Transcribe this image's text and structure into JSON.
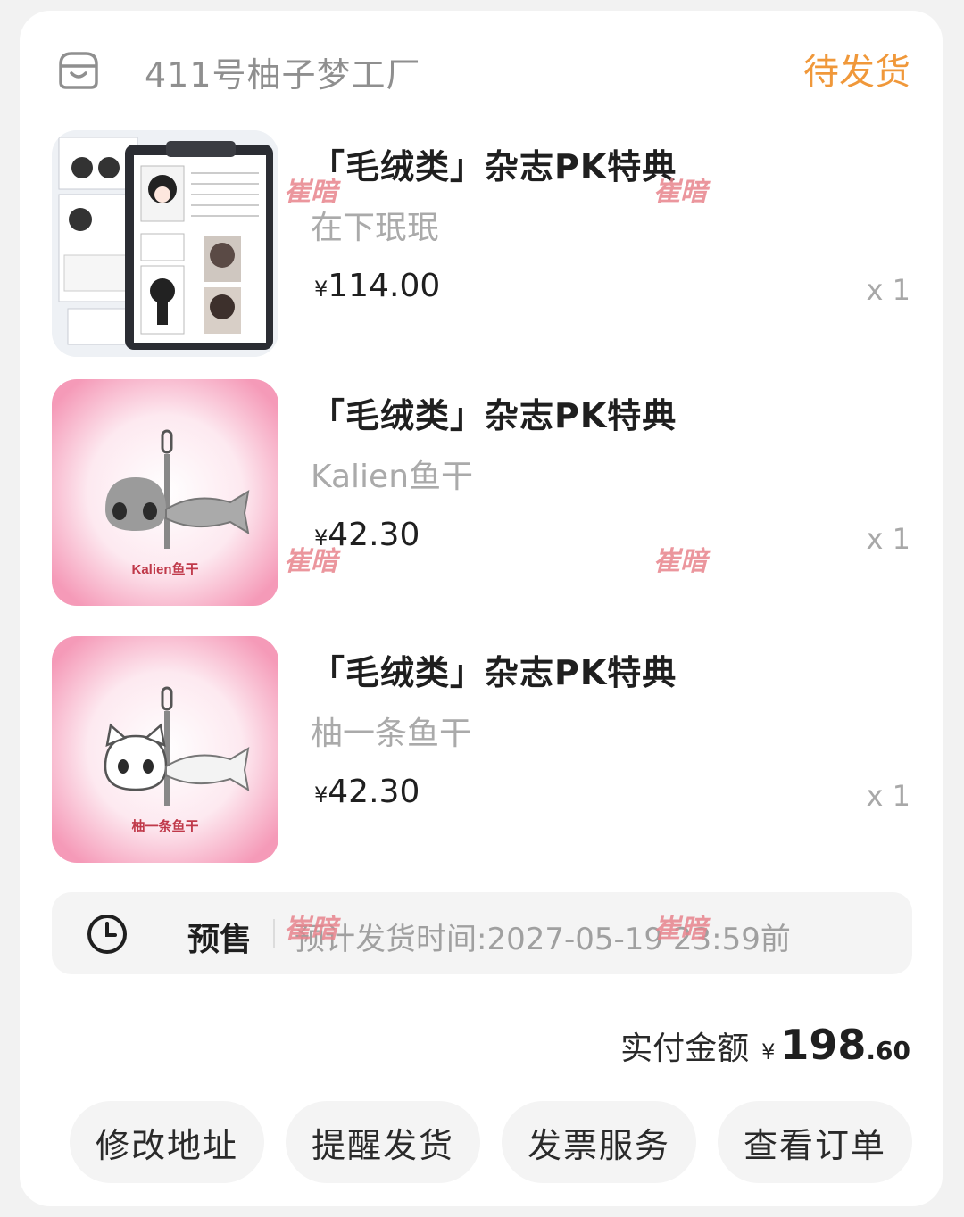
{
  "shop": {
    "name": "411号柚子梦工厂",
    "icon": "shop-icon",
    "status": "待发货"
  },
  "items": [
    {
      "title": "「毛绒类」杂志PK特典",
      "variant": "在下珉珉",
      "price_symbol": "¥",
      "price": "114.00",
      "qty": "x 1"
    },
    {
      "title": "「毛绒类」杂志PK特典",
      "variant": "Kalien鱼干",
      "price_symbol": "¥",
      "price": "42.30",
      "qty": "x 1",
      "image_label": "Kalien鱼干"
    },
    {
      "title": "「毛绒类」杂志PK特典",
      "variant": "柚一条鱼干",
      "price_symbol": "¥",
      "price": "42.30",
      "qty": "x 1",
      "image_label": "柚一条鱼干"
    }
  ],
  "presale": {
    "icon": "clock-icon",
    "label": "预售",
    "text": "预计发货时间:2027-05-19 23:59前"
  },
  "total": {
    "label": "实付金额",
    "symbol": "¥",
    "integer": "198",
    "decimal": ".60"
  },
  "actions": [
    "修改地址",
    "提醒发货",
    "发票服务",
    "查看订单"
  ],
  "watermark": "崔暗",
  "colors": {
    "status": "#f0983a",
    "pink": "#f7a9c1",
    "watermark": "#e8848d"
  }
}
